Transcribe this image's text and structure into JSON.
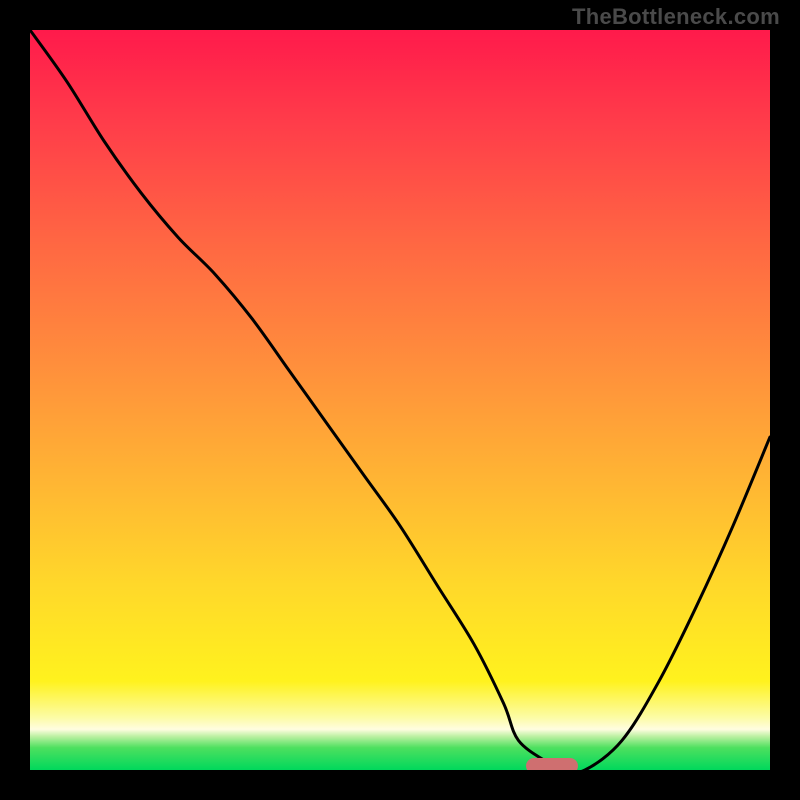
{
  "watermark": "TheBottleneck.com",
  "chart_data": {
    "type": "line",
    "x": [
      0.0,
      0.05,
      0.1,
      0.15,
      0.2,
      0.25,
      0.3,
      0.35,
      0.4,
      0.45,
      0.5,
      0.55,
      0.6,
      0.64,
      0.66,
      0.7,
      0.72,
      0.75,
      0.8,
      0.85,
      0.9,
      0.95,
      1.0
    ],
    "values": [
      1.0,
      0.93,
      0.85,
      0.78,
      0.72,
      0.67,
      0.61,
      0.54,
      0.47,
      0.4,
      0.33,
      0.25,
      0.17,
      0.09,
      0.04,
      0.01,
      0.0,
      0.0,
      0.04,
      0.12,
      0.22,
      0.33,
      0.45
    ],
    "xlim": [
      0,
      1
    ],
    "ylim": [
      0,
      1
    ],
    "xlabel": "",
    "ylabel": "",
    "title": "",
    "marker": {
      "x_start": 0.67,
      "x_end": 0.74,
      "y": 0.005
    },
    "colors": {
      "curve": "#000000",
      "marker": "#cf6f70",
      "gradient_top": "#ff1a4b",
      "gradient_mid": "#fff21e",
      "gradient_bottom": "#00d85c"
    }
  }
}
